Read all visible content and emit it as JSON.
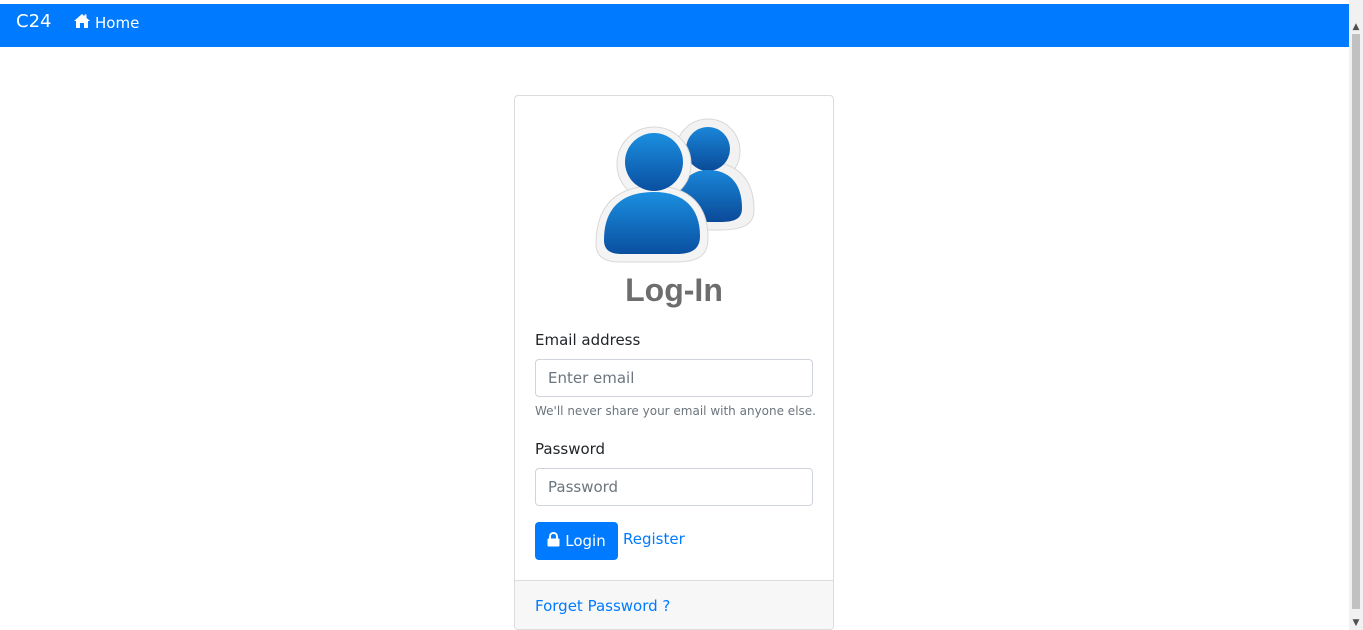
{
  "navbar": {
    "brand": "C24",
    "home_label": "Home",
    "color": "#007bff"
  },
  "card": {
    "title": "Log-In",
    "avatar_icon": "users-icon",
    "email": {
      "label": "Email address",
      "placeholder": "Enter email",
      "value": "",
      "help": "We'll never share your email with anyone else."
    },
    "password": {
      "label": "Password",
      "placeholder": "Password",
      "value": ""
    },
    "login_button": "Login",
    "login_icon": "lock-icon",
    "register_link": "Register",
    "forget_link": "Forget Password ?"
  }
}
